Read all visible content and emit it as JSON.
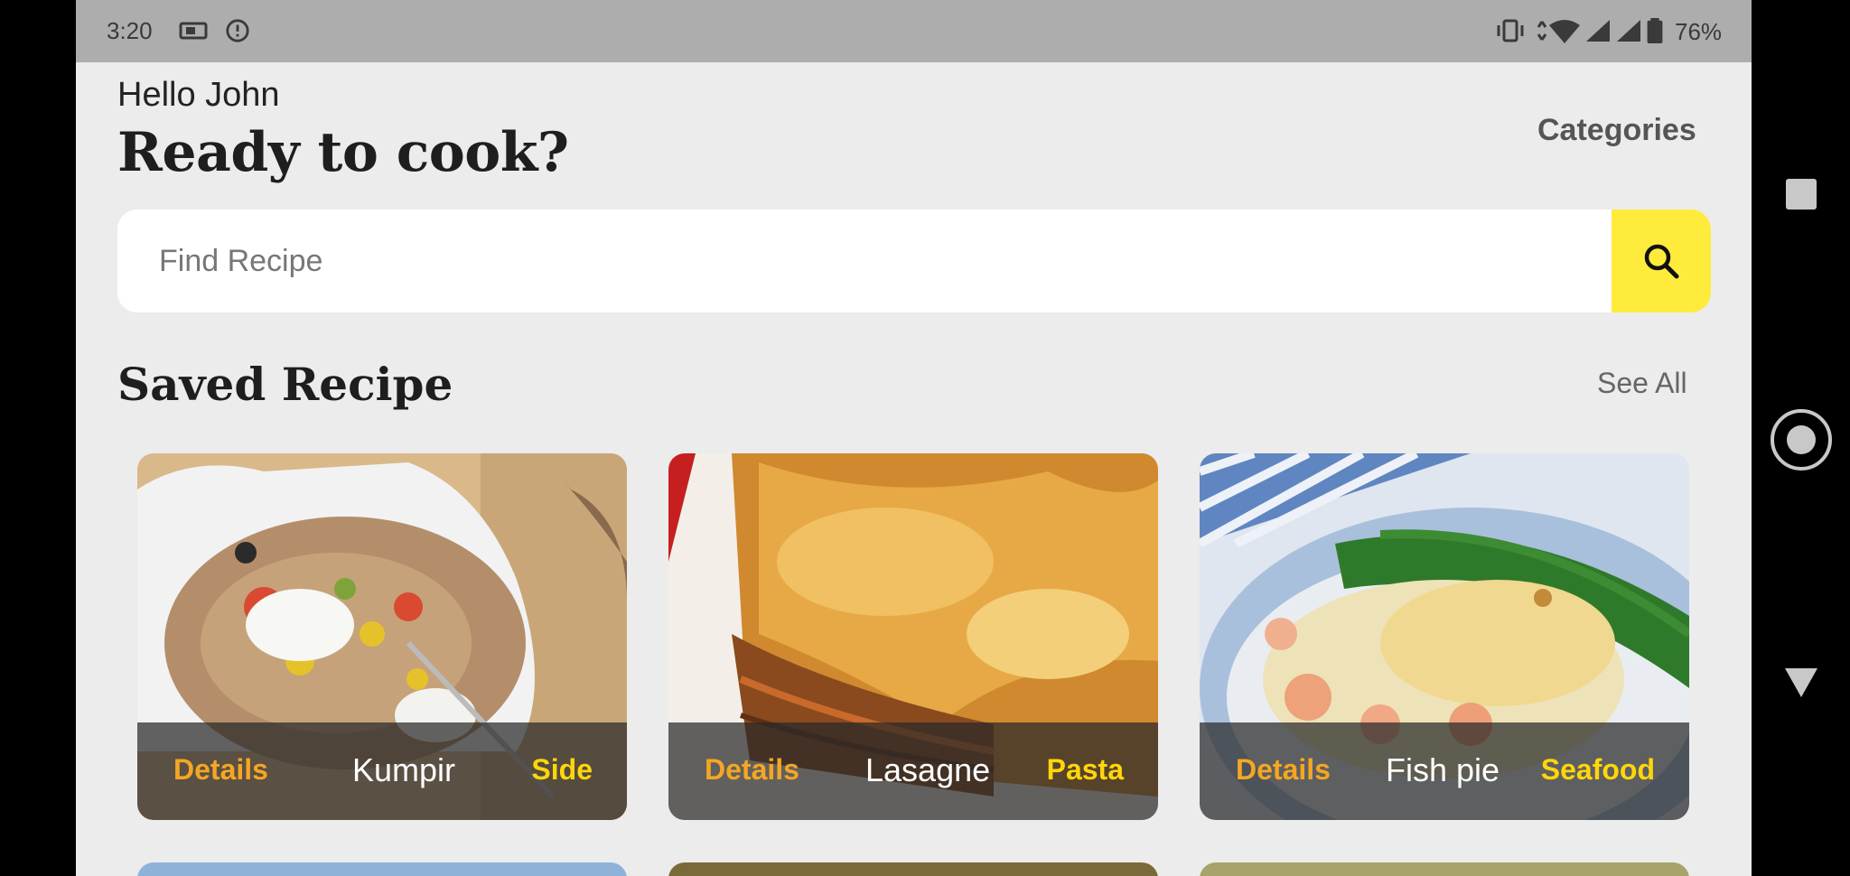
{
  "status": {
    "time": "3:20",
    "battery": "76%"
  },
  "header": {
    "greeting": "Hello John",
    "headline": "Ready to cook?",
    "categories": "Categories"
  },
  "search": {
    "placeholder": "Find Recipe",
    "value": ""
  },
  "section": {
    "title": "Saved Recipe",
    "see_all": "See All"
  },
  "cards": [
    {
      "details": "Details",
      "name": "Kumpir",
      "category": "Side"
    },
    {
      "details": "Details",
      "name": "Lasagne",
      "category": "Pasta"
    },
    {
      "details": "Details",
      "name": "Fish pie",
      "category": "Seafood"
    }
  ],
  "colors": {
    "accent": "#ffeb3b",
    "details": "#f5a623",
    "category": "#ffd60a",
    "background": "#ececec"
  },
  "icons": [
    "search-icon",
    "vibrate-icon",
    "wifi-icon",
    "signal-icon",
    "battery-icon",
    "recents-icon",
    "home-icon",
    "back-icon"
  ]
}
